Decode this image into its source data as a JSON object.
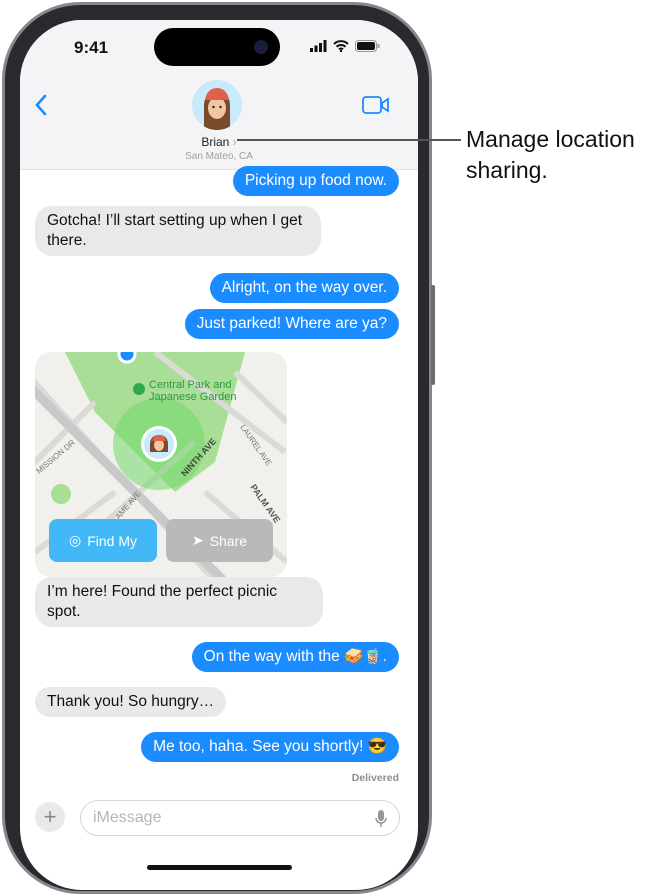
{
  "status_bar": {
    "time": "9:41"
  },
  "header": {
    "contact_name": "Brian",
    "location": "San Mateo, CA",
    "back_icon": "chevron-left-icon",
    "video_icon": "video-camera-icon"
  },
  "messages": [
    {
      "dir": "out",
      "text": "Picking up food now."
    },
    {
      "dir": "in",
      "text": "Gotcha! I’ll start setting up when I get there."
    },
    {
      "dir": "out",
      "text": "Alright, on the way over."
    },
    {
      "dir": "out",
      "text": "Just parked! Where are ya?"
    },
    {
      "dir": "in",
      "text": "I’m here! Found the perfect picnic spot."
    },
    {
      "dir": "out",
      "text": "On the way with the 🥪🧋."
    },
    {
      "dir": "in",
      "text": "Thank you! So hungry…"
    },
    {
      "dir": "out",
      "text": "Me too, haha. See you shortly! 😎"
    }
  ],
  "map": {
    "place": "Central Park and Japanese Garden",
    "streets": [
      "NINTH AVE",
      "LAUREL AVE",
      "PALM AVE",
      "MISSION DR",
      "AME AVE"
    ],
    "find_my_label": "Find My",
    "share_label": "Share",
    "accent": "#3db4f5",
    "park_color": "#9ddc8a"
  },
  "delivered": "Delivered",
  "composer": {
    "placeholder": "iMessage"
  },
  "callout": {
    "text": "Manage location sharing."
  },
  "colors": {
    "blue": "#1a8cff",
    "gray_bubble": "#e9e9eb"
  }
}
